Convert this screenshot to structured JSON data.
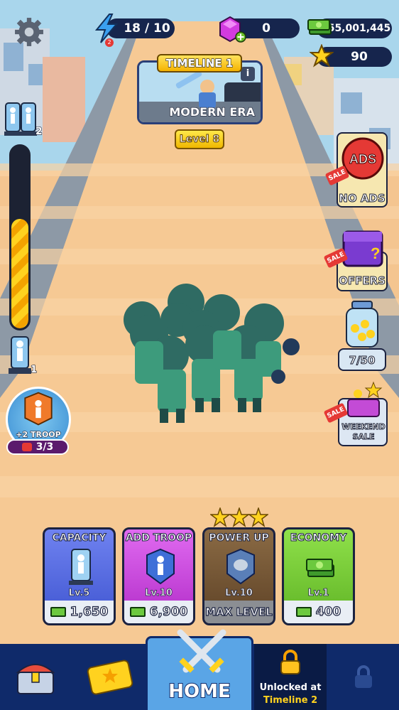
{
  "hud": {
    "energy": "18 / 10",
    "energy_badge": "2",
    "gems": "0",
    "cash": "55,001,445",
    "stars": "90"
  },
  "timeline": {
    "tag": "TIMELINE 1",
    "era": "MODERN ERA",
    "level": "Level 8"
  },
  "left_panel": {
    "troop_top_count": "2",
    "progress_fraction": 0.6,
    "troop_bottom_count": "1",
    "troop_bonus_label": "+2 TROOP",
    "troop_bonus_counter": "3/3"
  },
  "right_panel": {
    "ads_icon_text": "ADS",
    "sale_badge": "SALE",
    "no_ads_label": "NO ADS",
    "offers_label": "OFFERS",
    "jar_counter": "7/50",
    "weekend_label_line1": "WEEKEND",
    "weekend_label_line2": "SALE"
  },
  "upgrade_cards": [
    {
      "title": "CAPACITY",
      "level": "Lv.5",
      "price": "1,650",
      "color": "#4a63d8"
    },
    {
      "title": "ADD TROOP",
      "level": "Lv.10",
      "price": "6,900",
      "color": "#c233d6"
    },
    {
      "title": "POWER UP",
      "level": "Lv.10",
      "price": "MAX LEVEL",
      "color": "#6b4a2a"
    },
    {
      "title": "ECONOMY",
      "level": "Lv.1",
      "price": "400",
      "color": "#6cc12e"
    }
  ],
  "navbar": {
    "home_label": "HOME",
    "locked_line1": "Unlocked at",
    "locked_line2": "Timeline 2"
  },
  "colors": {
    "navy": "#16254d",
    "gold": "#ffd21f",
    "road": "#f3c28f"
  }
}
